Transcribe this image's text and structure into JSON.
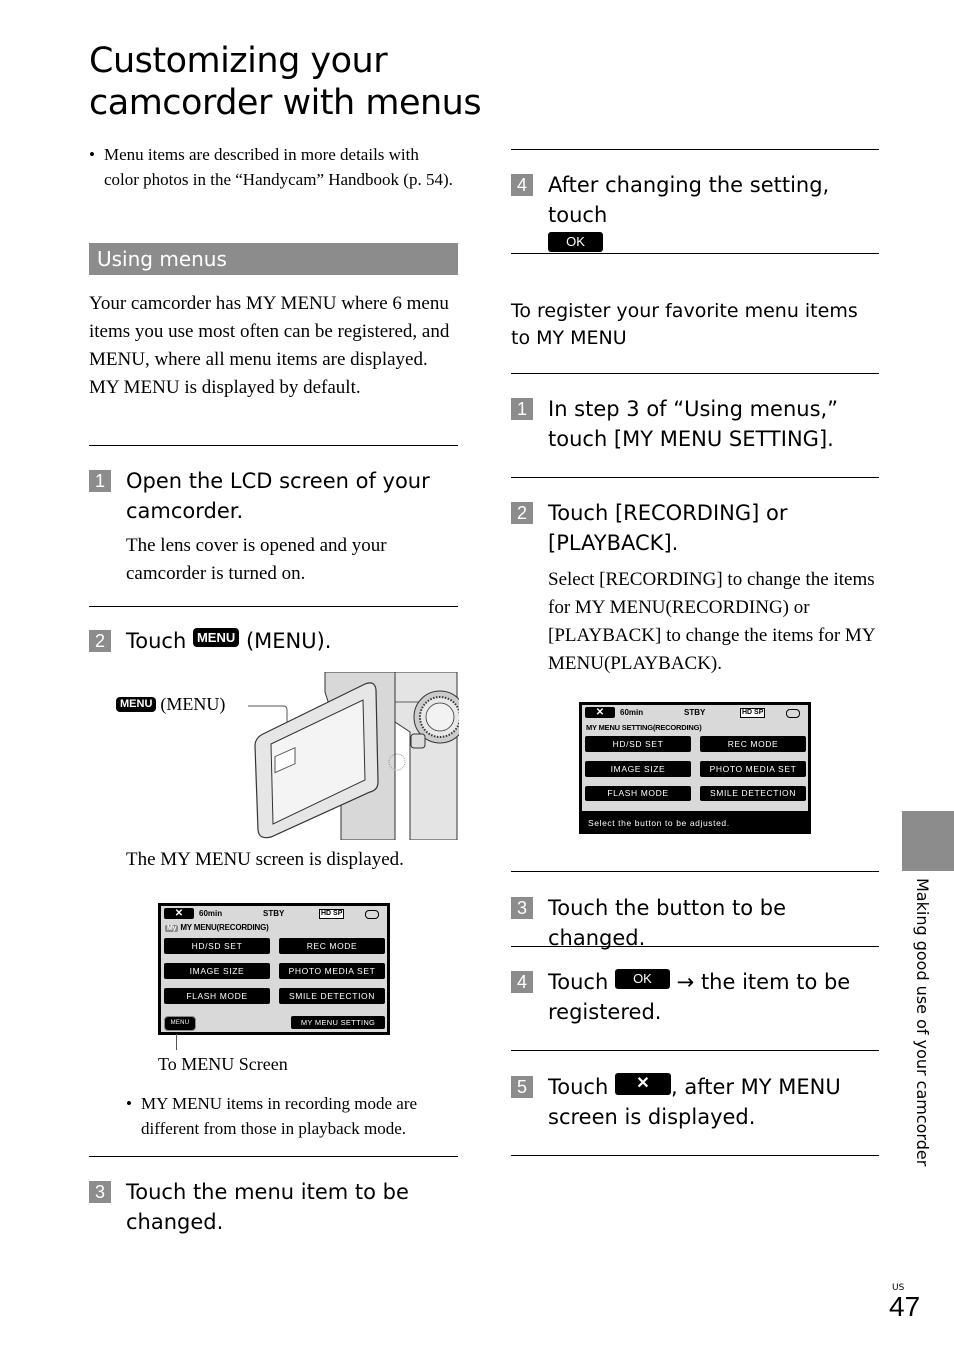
{
  "page": {
    "title": "Customizing your camcorder with menus",
    "intro_note": "Menu items are described in more details with color photos in the “Handycam” Handbook (p. 54).",
    "section_heading": "Using menus",
    "section_intro": "Your camcorder has MY MENU where 6 menu items you use most often can be registered, and MENU, where all menu items are displayed.",
    "section_intro_2": "MY MENU is displayed by default.",
    "side_tab_label": "Making good use of your camcorder",
    "page_region": "US",
    "page_number": "47"
  },
  "left_steps": [
    {
      "number": "1",
      "text": "Open the LCD screen of your camcorder.",
      "detail": "The lens cover is opened and your camcorder is turned on."
    },
    {
      "number": "2",
      "text_before": "Touch",
      "icon_label": "MENU",
      "text_after": "(MENU).",
      "callout_icon": "MENU",
      "callout_text": "(MENU)",
      "after_figure": "The MY MENU screen is displayed.",
      "screen_caption": "To MENU Screen",
      "note": "MY MENU items in recording mode are different from those in playback mode."
    },
    {
      "number": "3",
      "text": "Touch the menu item to be changed."
    }
  ],
  "right_steps_top": [
    {
      "number": "4",
      "text": "After changing the setting, touch",
      "button": "OK"
    }
  ],
  "register_heading": "To register your favorite menu items to MY MENU",
  "register_steps": [
    {
      "number": "1",
      "text": "In step 3 of “Using menus,” touch [MY MENU SETTING]."
    },
    {
      "number": "2",
      "text": "Touch [RECORDING] or [PLAYBACK].",
      "detail": "Select [RECORDING] to change the items for MY MENU(RECORDING) or [PLAYBACK] to change the items for MY MENU(PLAYBACK)."
    },
    {
      "number": "3",
      "text": "Touch the button to be changed."
    },
    {
      "number": "4",
      "text_before": "Touch",
      "button": "OK",
      "arrow": "→",
      "text_after": "the item to be registered."
    },
    {
      "number": "5",
      "text_before": "Touch",
      "button": "✕",
      "text_after": ", after MY MENU screen is displayed."
    }
  ],
  "screen_my_menu": {
    "close": "✕",
    "battery": "60min",
    "status": "STBY",
    "quality": "HD SP",
    "badge": "My",
    "heading": "MY MENU(RECORDING)",
    "buttons": [
      "HD/SD SET",
      "REC MODE",
      "IMAGE SIZE",
      "PHOTO MEDIA SET",
      "FLASH MODE",
      "SMILE DETECTION"
    ],
    "menu_button": "MENU",
    "setting_button": "MY MENU SETTING"
  },
  "screen_my_menu_setting": {
    "close": "✕",
    "battery": "60min",
    "status": "STBY",
    "quality": "HD SP",
    "heading": "MY MENU SETTING(RECORDING)",
    "buttons": [
      "HD/SD SET",
      "REC MODE",
      "IMAGE SIZE",
      "PHOTO MEDIA SET",
      "FLASH MODE",
      "SMILE DETECTION"
    ],
    "footer": "Select the button to be adjusted."
  }
}
